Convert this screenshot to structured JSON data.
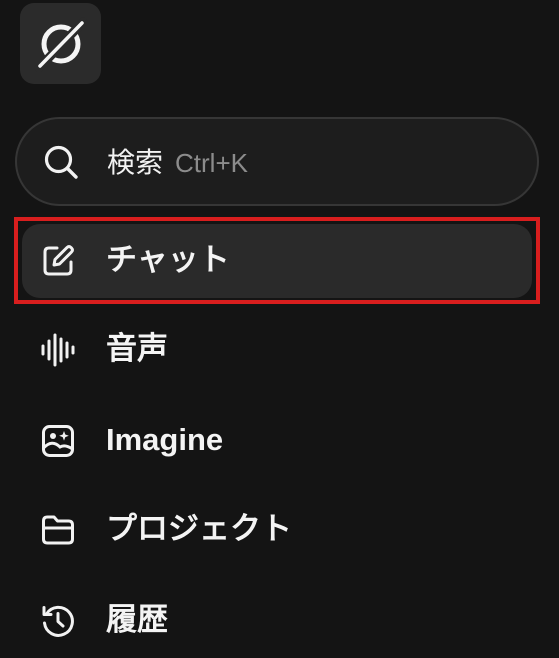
{
  "app": {
    "logo": "grok-logo-icon"
  },
  "search": {
    "label": "検索",
    "shortcut": "Ctrl+K",
    "icon": "search-icon"
  },
  "nav": {
    "items": [
      {
        "label": "チャット",
        "icon": "edit-icon",
        "active": true
      },
      {
        "label": "音声",
        "icon": "waveform-icon",
        "active": false
      },
      {
        "label": "Imagine",
        "icon": "image-sparkle-icon",
        "active": false
      },
      {
        "label": "プロジェクト",
        "icon": "folder-icon",
        "active": false
      },
      {
        "label": "履歴",
        "icon": "history-icon",
        "active": false
      }
    ]
  },
  "colors": {
    "background": "#141414",
    "active_item": "#2a2a2a",
    "highlight": "#d81e1e",
    "muted_text": "#8c8c8c"
  }
}
